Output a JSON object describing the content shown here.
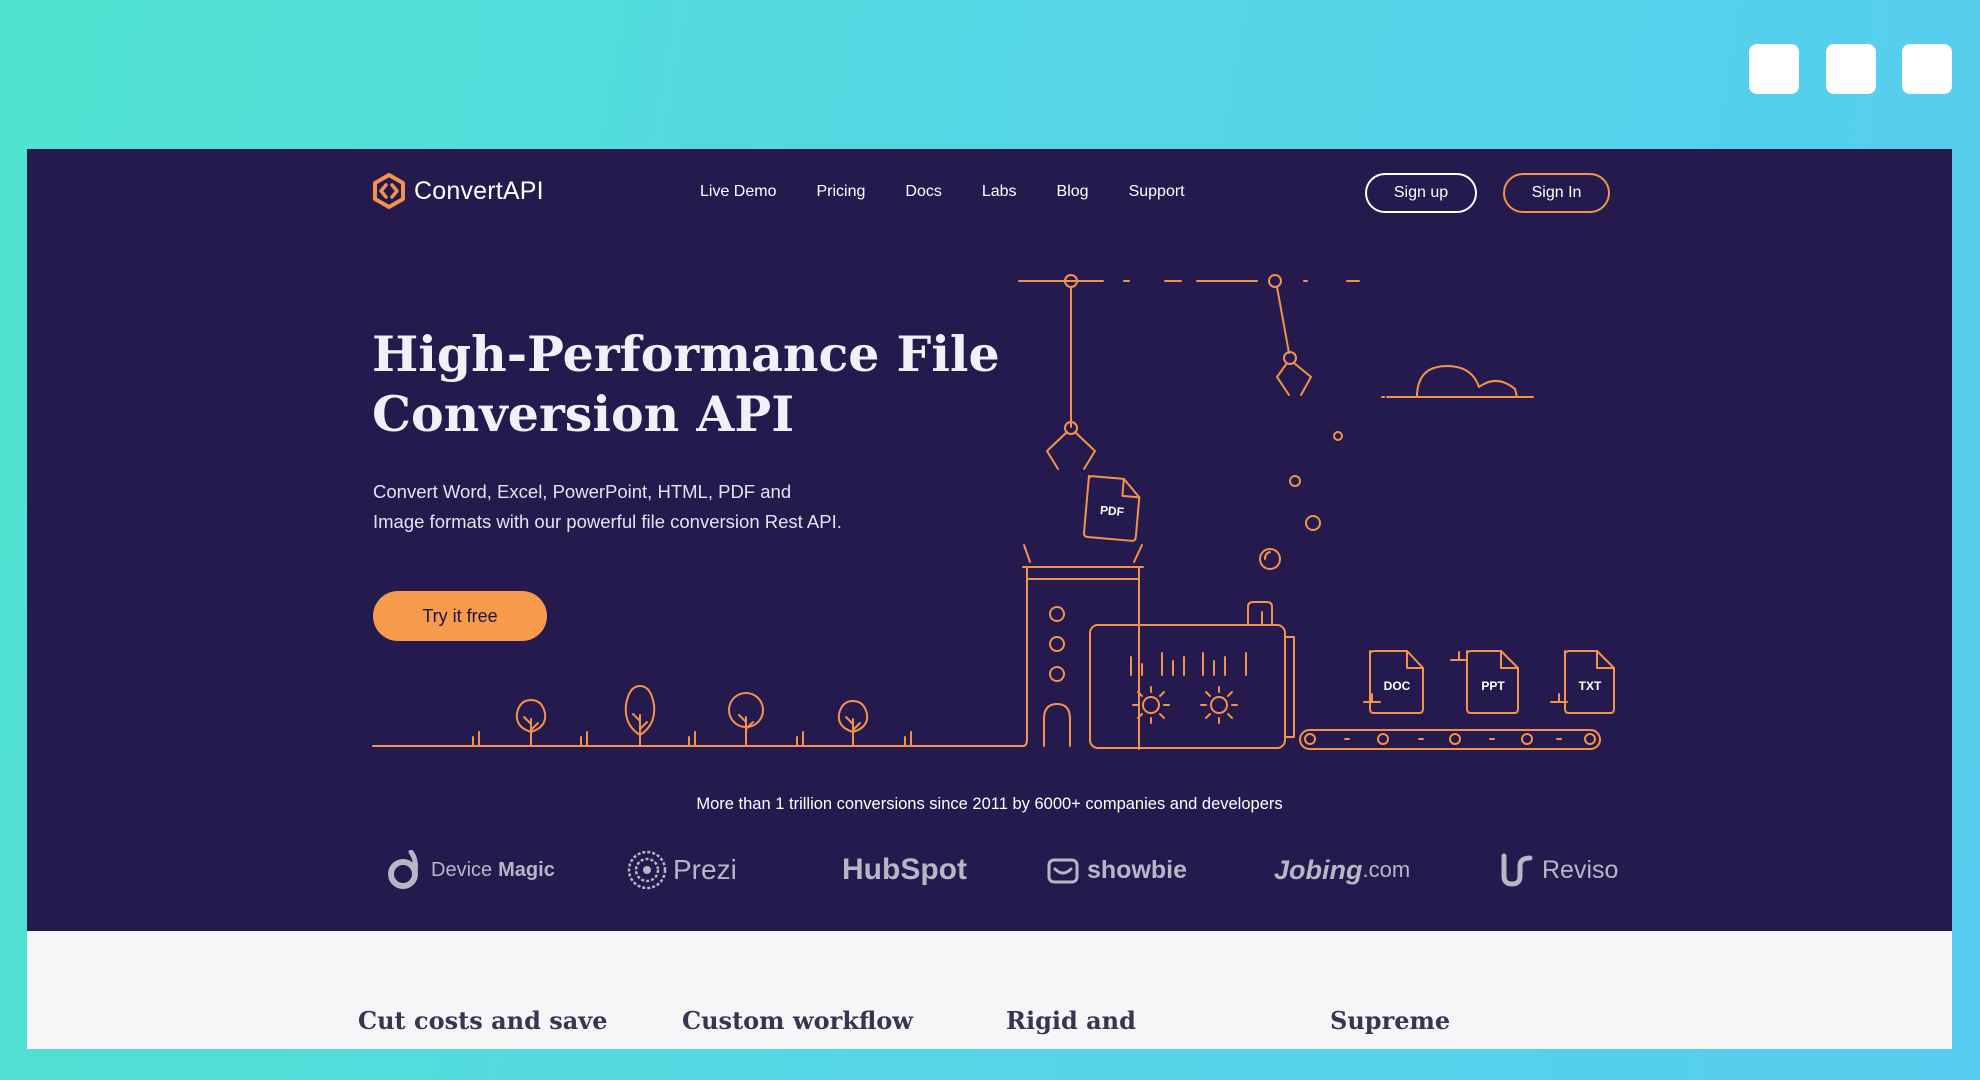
{
  "window_controls": [
    "window-button",
    "window-button",
    "window-button"
  ],
  "header": {
    "logo_text": "ConvertAPI",
    "nav": [
      "Live Demo",
      "Pricing",
      "Docs",
      "Labs",
      "Blog",
      "Support"
    ],
    "signup": "Sign up",
    "signin": "Sign In"
  },
  "hero": {
    "title_line1": "High-Performance File",
    "title_line2": "Conversion API",
    "subtext": "Convert Word, Excel, PowerPoint, HTML, PDF and Image formats with our powerful file conversion Rest API.",
    "cta": "Try it free"
  },
  "illustration": {
    "file_labels": [
      "PDF",
      "DOC",
      "PPT",
      "TXT"
    ]
  },
  "tagline": "More than 1 trillion conversions since 2011 by 6000+ companies and developers",
  "brands": {
    "device_magic_a": "Device",
    "device_magic_b": "Magic",
    "prezi": "Prezi",
    "hubspot": "HubSpot",
    "showbie": "showbie",
    "jobing_a": "Jobing",
    "jobing_b": ".com",
    "reviso": "Reviso"
  },
  "features": [
    "Cut costs and save",
    "Custom workflow",
    "Rigid and",
    "Supreme"
  ],
  "colors": {
    "hero_bg": "#241a4e",
    "accent": "#f69a4c",
    "page_bg_teal": "#4fe3cf"
  }
}
